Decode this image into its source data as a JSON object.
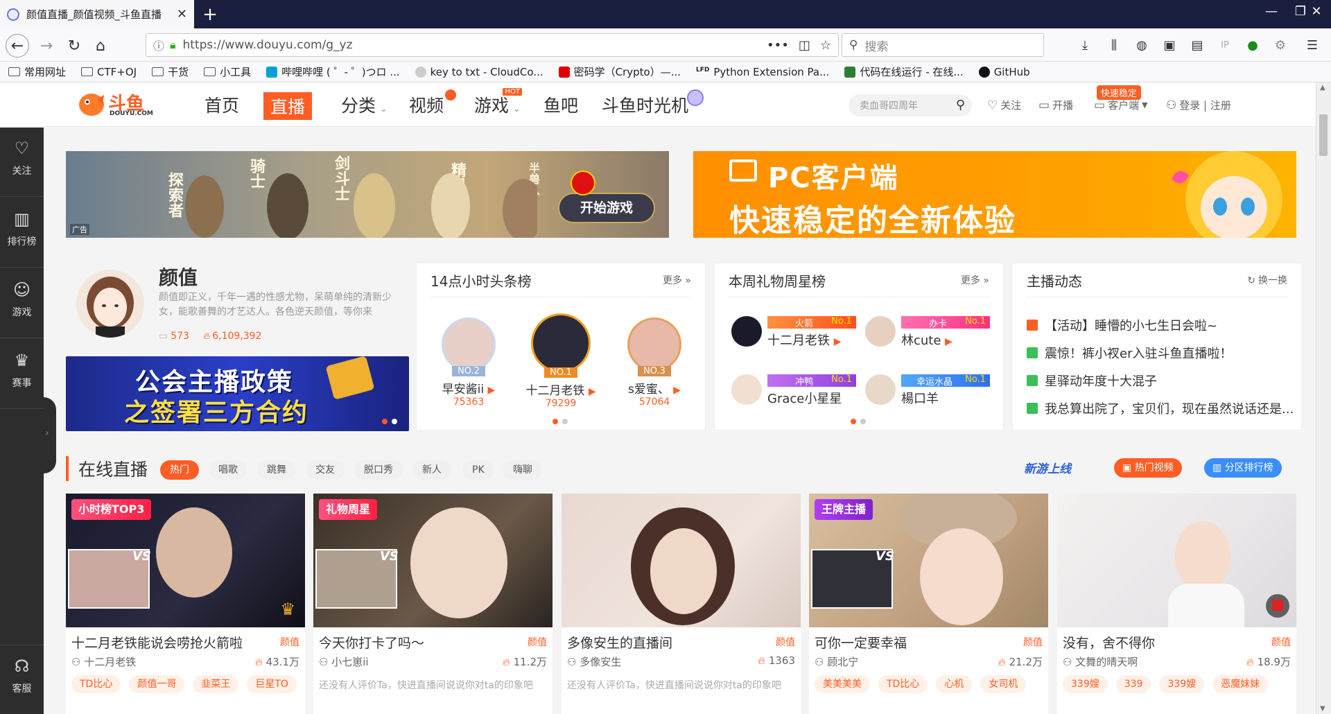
{
  "browser": {
    "tab_title": "颜值直播_颜值视频_斗鱼直播",
    "url": "https://www.douyu.com/g_yz",
    "search_placeholder": "搜索",
    "bookmarks": [
      "常用网址",
      "CTF+OJ",
      "干货",
      "小工具",
      "哔哩哔哩 ( ゜- ゜)つロ ...",
      "key to txt - CloudCo...",
      "密码学（Crypto）—...",
      "Python Extension Pa...",
      "代码在线运行 - 在线...",
      "GitHub"
    ]
  },
  "site": {
    "logo_text": "斗鱼",
    "logo_sub": "DOUYU.COM",
    "nav": [
      "首页",
      "直播",
      "分类",
      "视频",
      "游戏",
      "鱼吧",
      "斗鱼时光机"
    ],
    "hot_badge": "HOT",
    "search_placeholder": "卖血哥四周年",
    "follow": "关注",
    "broadcast": "开播",
    "client": "客户端",
    "fast_badge": "快速稳定",
    "login": "登录 | 注册"
  },
  "sidebar": [
    "关注",
    "排行榜",
    "游戏",
    "赛事",
    "客服"
  ],
  "ads": {
    "left_label": "广告",
    "left_roles": [
      "探索者",
      "骑士",
      "剑斗士",
      "精灵",
      "半兽人"
    ],
    "left_button": "开始游戏",
    "right_line1": "PC客户端",
    "right_line2": "快速稳定的全新体验"
  },
  "category": {
    "name": "颜值",
    "desc": "颜值即正义，千年一遇的性感尤物，呆萌单纯的清新少女，能歌善舞的才艺达人。各色逆天颜值，等你来",
    "rooms": "573",
    "heat": "6,109,392",
    "banner_line1": "公会主播政策",
    "banner_line2": "之签署三方合约"
  },
  "hourly": {
    "title": "14点小时头条榜",
    "more": "更多",
    "entries": [
      {
        "rank": "NO.2",
        "name": "早安酱ii",
        "score": "75363"
      },
      {
        "rank": "NO.1",
        "name": "十二月老铁",
        "score": "79299"
      },
      {
        "rank": "NO.3",
        "name": "s爱蜜、",
        "score": "57064"
      }
    ]
  },
  "giftstars": {
    "title": "本周礼物周星榜",
    "more": "更多",
    "entries": [
      {
        "gift": "火箭",
        "rank": "No.1",
        "name": "十二月老铁"
      },
      {
        "gift": "办卡",
        "rank": "No.1",
        "name": "林cute"
      },
      {
        "gift": "冲鸭",
        "rank": "No.1",
        "name": "Grace小星星"
      },
      {
        "gift": "幸运水晶",
        "rank": "No.1",
        "name": "楊口羊"
      }
    ]
  },
  "feed": {
    "title": "主播动态",
    "refresh": "换一换",
    "items": [
      "【活动】睡懵的小七生日会啦~",
      "震惊！裤小衩er入驻斗鱼直播啦！",
      "星驿动年度十大混子",
      "我总算出院了，宝贝们，现在虽然说话还是..."
    ]
  },
  "online": {
    "title": "在线直播",
    "tags": [
      "热门",
      "唱歌",
      "跳舞",
      "交友",
      "脱口秀",
      "新人",
      "PK",
      "嗨聊"
    ],
    "promo": "新游上线",
    "hot_video": "热门视频",
    "rank_btn": "分区排行榜"
  },
  "cards": [
    {
      "badge": "小时榜TOP3",
      "title": "十二月老铁能说会唠抢火箭啦",
      "cat": "颜值",
      "author": "十二月老铁",
      "views": "43.1万",
      "tags": [
        "TD比心",
        "颜值一哥",
        "韭菜王",
        "巨星TO"
      ],
      "comment": ""
    },
    {
      "badge": "礼物周星",
      "title": "今天你打卡了吗～",
      "cat": "颜值",
      "author": "小七崽ii",
      "views": "11.2万",
      "tags": [],
      "comment": "还没有人评价Ta，快进直播间说说你对ta的印象吧"
    },
    {
      "badge": "",
      "title": "多像安生的直播间",
      "cat": "颜值",
      "author": "多像安生",
      "views": "1363",
      "tags": [],
      "comment": "还没有人评价Ta，快进直播间说说你对ta的印象吧"
    },
    {
      "badge": "王牌主播",
      "title": "可你一定要幸福",
      "cat": "颜值",
      "author": "顾北宁",
      "views": "21.2万",
      "tags": [
        "美美美美",
        "TD比心",
        "心机",
        "女司机"
      ],
      "comment": ""
    },
    {
      "badge": "",
      "title": "没有，舍不得你",
      "cat": "颜值",
      "author": "文舞的晴天啊",
      "views": "18.9万",
      "tags": [
        "339嫂",
        "339",
        "339嫂",
        "恶魔妹妹"
      ],
      "comment": ""
    }
  ],
  "colors": {
    "accent": "#ff5d23",
    "sidebar": "#2d2d2d",
    "tabbar": "#1b1f3f"
  }
}
